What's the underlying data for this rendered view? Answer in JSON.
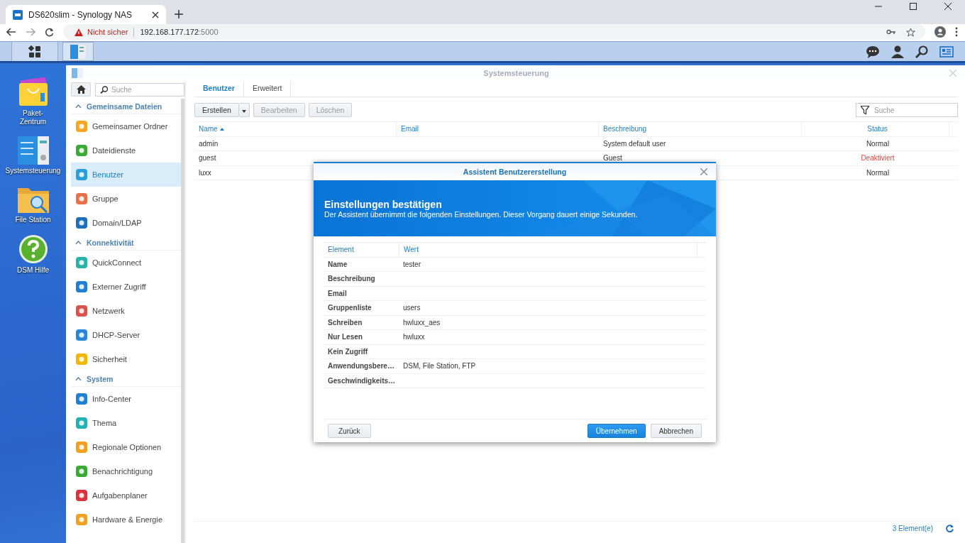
{
  "browser": {
    "tab_title": "DS620slim - Synology NAS",
    "security": "Nicht sicher",
    "url_host": "192.168.177.172",
    "url_port": ":5000"
  },
  "desktop_icons": [
    {
      "label": "Paket-Zentrum"
    },
    {
      "label": "Systemsteuerung"
    },
    {
      "label": "File Station"
    },
    {
      "label": "DSM Hilfe"
    }
  ],
  "window": {
    "title": "Systemsteuerung",
    "search_placeholder": "Suche"
  },
  "sidebar": [
    {
      "title": "Gemeinsame Dateien",
      "expanded": true,
      "items": [
        {
          "label": "Gemeinsamer Ordner",
          "selected": false
        },
        {
          "label": "Dateidienste",
          "selected": false
        },
        {
          "label": "Benutzer",
          "selected": true
        },
        {
          "label": "Gruppe",
          "selected": false
        },
        {
          "label": "Domain/LDAP",
          "selected": false
        }
      ]
    },
    {
      "title": "Konnektivität",
      "expanded": true,
      "items": [
        {
          "label": "QuickConnect",
          "selected": false
        },
        {
          "label": "Externer Zugriff",
          "selected": false
        },
        {
          "label": "Netzwerk",
          "selected": false
        },
        {
          "label": "DHCP-Server",
          "selected": false
        },
        {
          "label": "Sicherheit",
          "selected": false
        }
      ]
    },
    {
      "title": "System",
      "expanded": true,
      "items": [
        {
          "label": "Info-Center",
          "selected": false
        },
        {
          "label": "Thema",
          "selected": false
        },
        {
          "label": "Regionale Optionen",
          "selected": false
        },
        {
          "label": "Benachrichtigung",
          "selected": false
        },
        {
          "label": "Aufgabenplaner",
          "selected": false
        },
        {
          "label": "Hardware & Energie",
          "selected": false
        }
      ]
    }
  ],
  "tabs": [
    {
      "label": "Benutzer",
      "selected": true
    },
    {
      "label": "Erweitert",
      "selected": false
    }
  ],
  "toolbar": {
    "create": "Erstellen",
    "buttons": [
      {
        "label": "Bearbeiten",
        "disabled": true
      },
      {
        "label": "Löschen",
        "disabled": true
      }
    ],
    "filter_placeholder": "Suche"
  },
  "table": {
    "columns": [
      {
        "label": "Name",
        "sorted": true
      },
      {
        "label": "Email",
        "sorted": false
      },
      {
        "label": "Beschreibung",
        "sorted": false
      },
      {
        "label": "Status",
        "sorted": false
      }
    ],
    "rows": [
      {
        "name": "admin",
        "description": "System default user",
        "status": "Normal",
        "disabled": false
      },
      {
        "name": "guest",
        "description": "Guest",
        "status": "Deaktiviert",
        "disabled": true
      },
      {
        "name": "luxx",
        "status": "Normal",
        "disabled": false
      }
    ]
  },
  "footer": {
    "count": "3 Element(e)"
  },
  "dialog": {
    "title": "Assistent Benutzererstellung",
    "banner_title": "Einstellungen bestätigen",
    "banner_text": "Der Assistent übernimmt die folgenden Einstellungen. Dieser Vorgang dauert einige Sekunden.",
    "columns": [
      "Element",
      "Wert"
    ],
    "rows": [
      {
        "label": "Name",
        "value": "tester"
      },
      {
        "label": "Beschreibung"
      },
      {
        "label": "Email"
      },
      {
        "label": "Gruppenliste",
        "value": "users"
      },
      {
        "label": "Schreiben",
        "value": "hwluxx_aes"
      },
      {
        "label": "Nur Lesen",
        "value": "hwluxx"
      },
      {
        "label": "Kein Zugriff"
      },
      {
        "label": "Anwendungsbere…",
        "value": "DSM, File Station, FTP"
      },
      {
        "label": "Geschwindigkeits…"
      }
    ],
    "buttons": [
      {
        "label": "Zurück",
        "kind": "back"
      },
      {
        "label": "Übernehmen",
        "kind": "primary"
      },
      {
        "label": "Abbrechen",
        "kind": "default"
      }
    ]
  }
}
